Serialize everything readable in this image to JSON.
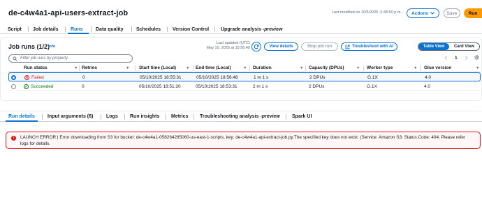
{
  "header": {
    "job_title": "de-c4w4a1-api-users-extract-job",
    "last_modified": "Last modified on 10/5/2025, 6:48:59 p.m.",
    "actions_label": "Actions",
    "save_label": "Save",
    "run_label": "Run"
  },
  "top_tabs": [
    {
      "label": "Script"
    },
    {
      "label": "Job details"
    },
    {
      "label": "Runs"
    },
    {
      "label": "Data quality"
    },
    {
      "label": "Schedules"
    },
    {
      "label": "Version Control"
    },
    {
      "label": "Upgrade analysis - ",
      "suffix": "preview"
    }
  ],
  "runs": {
    "title": "Job runs (1/2)",
    "info_label": "Info",
    "last_updated_line1": "Last updated (UTC)",
    "last_updated_line2": "May 10, 2025 at 15:56:40",
    "view_details_label": "View details",
    "stop_job_run_label": "Stop job run",
    "troubleshoot_label": "Troubleshoot with AI",
    "table_view_label": "Table View",
    "card_view_label": "Card View",
    "filter_placeholder": "Filter job runs by property",
    "page_number": "1"
  },
  "table": {
    "columns": [
      "Run status",
      "Retries",
      "Start time (Local)",
      "End time (Local)",
      "Duration",
      "Capacity (DPUs)",
      "Worker type",
      "Glue version"
    ],
    "rows": [
      {
        "status": "Failed",
        "retries": "0",
        "start": "05/10/2025 18:55:31",
        "end": "05/10/2025 18:56:48",
        "duration": "1 m 1 s",
        "capacity": "2 DPUs",
        "worker": "G.1X",
        "glue": "4.0"
      },
      {
        "status": "Succeeded",
        "retries": "0",
        "start": "05/10/2025 18:51:20",
        "end": "05/10/2025 18:53:31",
        "duration": "2 m 1 s",
        "capacity": "2 DPUs",
        "worker": "G.1X",
        "glue": "4.0"
      }
    ]
  },
  "bottom_tabs": [
    {
      "label": "Run details"
    },
    {
      "label": "Input arguments (6)"
    },
    {
      "label": "Logs"
    },
    {
      "label": "Run insights"
    },
    {
      "label": "Metrics"
    },
    {
      "label": "Troubleshooting analysis - ",
      "suffix": "preview"
    },
    {
      "label": "Spark UI"
    }
  ],
  "error": {
    "message": "LAUNCH ERROR | Error downloading from S3 for bucket: de-c4w4a1-058264285060-us-east-1-scripts, key: de-c4w4a1-api-extract-job.py.The specified key does not exist. (Service: Amazon S3; Status Code: 404; Please refer logs for details."
  },
  "colors": {
    "accent": "#0972d3",
    "run_button": "#ff9900",
    "failed": "#d91515",
    "succeeded": "#037f0c"
  },
  "icons": [
    "chevron-down-icon",
    "refresh-icon",
    "external-link-icon",
    "search-icon",
    "chevron-left-icon",
    "chevron-right-icon",
    "settings-gear-icon",
    "sort-caret-icon",
    "failed-status-icon",
    "success-status-icon",
    "error-icon"
  ]
}
